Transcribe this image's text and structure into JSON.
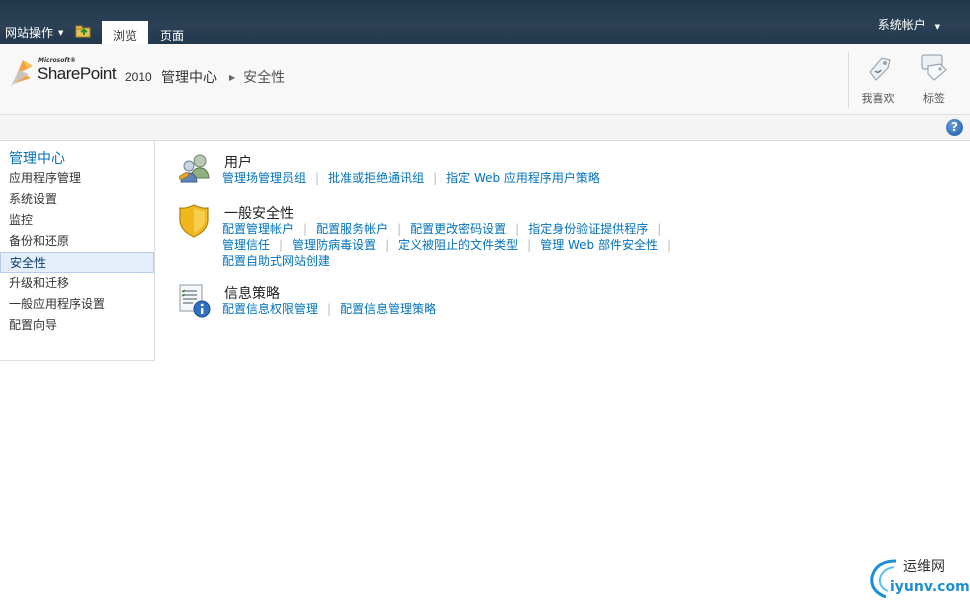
{
  "ribbon": {
    "site_actions": "网站操作",
    "tabs": [
      {
        "label": "浏览",
        "active": true
      },
      {
        "label": "页面",
        "active": false
      }
    ],
    "user": "系统帐户"
  },
  "logo": {
    "microsoft": "Microsoft®",
    "product": "SharePoint",
    "year": "2010"
  },
  "breadcrumb": {
    "root": "管理中心",
    "current": "安全性"
  },
  "social": {
    "like": "我喜欢",
    "tags": "标签"
  },
  "help": {
    "glyph": "?"
  },
  "leftnav": {
    "heading": "管理中心",
    "items": [
      {
        "label": "应用程序管理"
      },
      {
        "label": "系统设置"
      },
      {
        "label": "监控"
      },
      {
        "label": "备份和还原"
      },
      {
        "label": "安全性",
        "selected": true
      },
      {
        "label": "升级和迁移"
      },
      {
        "label": "一般应用程序设置"
      },
      {
        "label": "配置向导"
      }
    ]
  },
  "groups": {
    "users": {
      "title": "用户",
      "icon": "users-icon",
      "links": [
        "管理场管理员组",
        "批准或拒绝通讯组",
        "指定 Web 应用程序用户策略"
      ]
    },
    "security": {
      "title": "一般安全性",
      "icon": "shield-icon",
      "links_row1": [
        "配置管理帐户",
        "配置服务帐户",
        "配置更改密码设置",
        "指定身份验证提供程序"
      ],
      "links_row2": [
        "管理信任",
        "管理防病毒设置",
        "定义被阻止的文件类型",
        "管理 Web 部件安全性"
      ],
      "links_row3": [
        "配置自助式网站创建"
      ]
    },
    "policy": {
      "title": "信息策略",
      "icon": "info-policy-icon",
      "links": [
        "配置信息权限管理",
        "配置信息管理策略"
      ]
    }
  },
  "watermark": {
    "line1": "运维网",
    "line2": "iyunv.com"
  },
  "colors": {
    "ribbon": "#21374c",
    "link": "#0072bc",
    "selected": "#e4eefb"
  }
}
